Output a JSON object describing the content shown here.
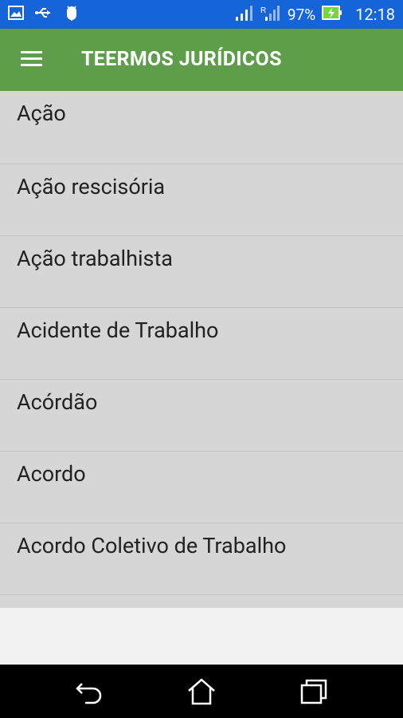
{
  "status_bar": {
    "battery_percent": "97%",
    "time": "12:18",
    "icons": [
      "image-notification-icon",
      "usb-icon",
      "android-debug-icon",
      "signal-icon",
      "signal-roaming-icon",
      "battery-charging-icon"
    ]
  },
  "toolbar": {
    "title": "TEERMOS JURÍDICOS",
    "menu_icon": "hamburger-menu-icon"
  },
  "terms": [
    "Ação",
    "Ação rescisória",
    "Ação trabalhista",
    "Acidente de Trabalho",
    "Acórdão",
    "Acordo",
    "Acordo Coletivo de Trabalho",
    ""
  ],
  "nav_bar": {
    "icons": [
      "back-icon",
      "home-icon",
      "recent-apps-icon"
    ]
  },
  "colors": {
    "status_bar": "#1565d8",
    "toolbar": "#5e9e4b",
    "list_background": "#d6d6d6",
    "battery_charging": "#7bd43a"
  }
}
